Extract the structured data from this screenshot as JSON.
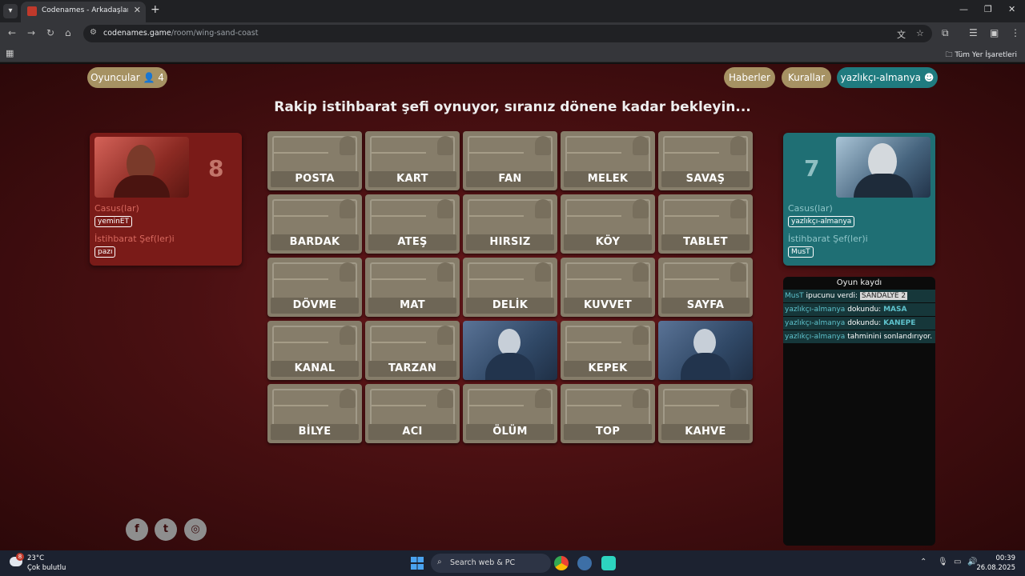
{
  "browser": {
    "tab_title": "Codenames - Arkadaşlarınızla çevrimiçi",
    "url_host": "codenames.game",
    "url_path": "/room/wing-sand-coast",
    "bookmarks_all": "Tüm Yer İşaretleri"
  },
  "header": {
    "players_label": "Oyuncular",
    "players_count": "4",
    "news_label": "Haberler",
    "rules_label": "Kurallar",
    "user_label": "yazlıkçı-almanya"
  },
  "status_message": "Rakip istihbarat şefi oynuyor, sıranız dönene kadar bekleyin...",
  "red_team": {
    "score": "8",
    "operatives_label": "Casus(lar)",
    "operatives": [
      "yeminET"
    ],
    "spymasters_label": "İstihbarat Şef(ler)i",
    "spymasters": [
      "pazı"
    ]
  },
  "blue_team": {
    "score": "7",
    "operatives_label": "Casus(lar)",
    "operatives": [
      "yazlıkçı-almanya"
    ],
    "spymasters_label": "İstihbarat Şef(ler)i",
    "spymasters": [
      "MusT"
    ]
  },
  "board": [
    {
      "word": "POSTA",
      "revealed": false
    },
    {
      "word": "KART",
      "revealed": false
    },
    {
      "word": "FAN",
      "revealed": false
    },
    {
      "word": "MELEK",
      "revealed": false
    },
    {
      "word": "SAVAŞ",
      "revealed": false
    },
    {
      "word": "BARDAK",
      "revealed": false
    },
    {
      "word": "ATEŞ",
      "revealed": false
    },
    {
      "word": "HIRSIZ",
      "revealed": false
    },
    {
      "word": "KÖY",
      "revealed": false
    },
    {
      "word": "TABLET",
      "revealed": false
    },
    {
      "word": "DÖVME",
      "revealed": false
    },
    {
      "word": "MAT",
      "revealed": false
    },
    {
      "word": "DELİK",
      "revealed": false
    },
    {
      "word": "KUVVET",
      "revealed": false
    },
    {
      "word": "SAYFA",
      "revealed": false
    },
    {
      "word": "KANAL",
      "revealed": false
    },
    {
      "word": "TARZAN",
      "revealed": false
    },
    {
      "word": "",
      "revealed": true
    },
    {
      "word": "KEPEK",
      "revealed": false
    },
    {
      "word": "",
      "revealed": true
    },
    {
      "word": "BİLYE",
      "revealed": false
    },
    {
      "word": "ACI",
      "revealed": false
    },
    {
      "word": "ÖLÜM",
      "revealed": false
    },
    {
      "word": "TOP",
      "revealed": false
    },
    {
      "word": "KAHVE",
      "revealed": false
    }
  ],
  "game_log": {
    "title": "Oyun kaydı",
    "entries": [
      {
        "who": "MusT",
        "text": " ipucunu verdi: ",
        "highlight": "SANDALYE 2",
        "style": "clue"
      },
      {
        "who": "yazlıkçı-almanya",
        "text": " dokundu: ",
        "highlight": "MASA",
        "style": "word"
      },
      {
        "who": "yazlıkçı-almanya",
        "text": " dokundu: ",
        "highlight": "KANEPE",
        "style": "word"
      },
      {
        "who": "yazlıkçı-almanya",
        "text": " tahminini sonlandırıyor.",
        "highlight": "",
        "style": "none"
      }
    ]
  },
  "social": [
    "facebook-icon",
    "twitter-icon",
    "instagram-icon"
  ],
  "taskbar": {
    "temperature": "23°C",
    "weather": "Çok bulutlu",
    "weather_badge": "8",
    "search_label": "Search web & PC",
    "time": "00:39",
    "date": "26.08.2025"
  },
  "colors": {
    "red_team": "#7a1b18",
    "blue_team": "#1f6f74",
    "card": "#867d6a",
    "log_highlight": "#5ec2cc"
  }
}
